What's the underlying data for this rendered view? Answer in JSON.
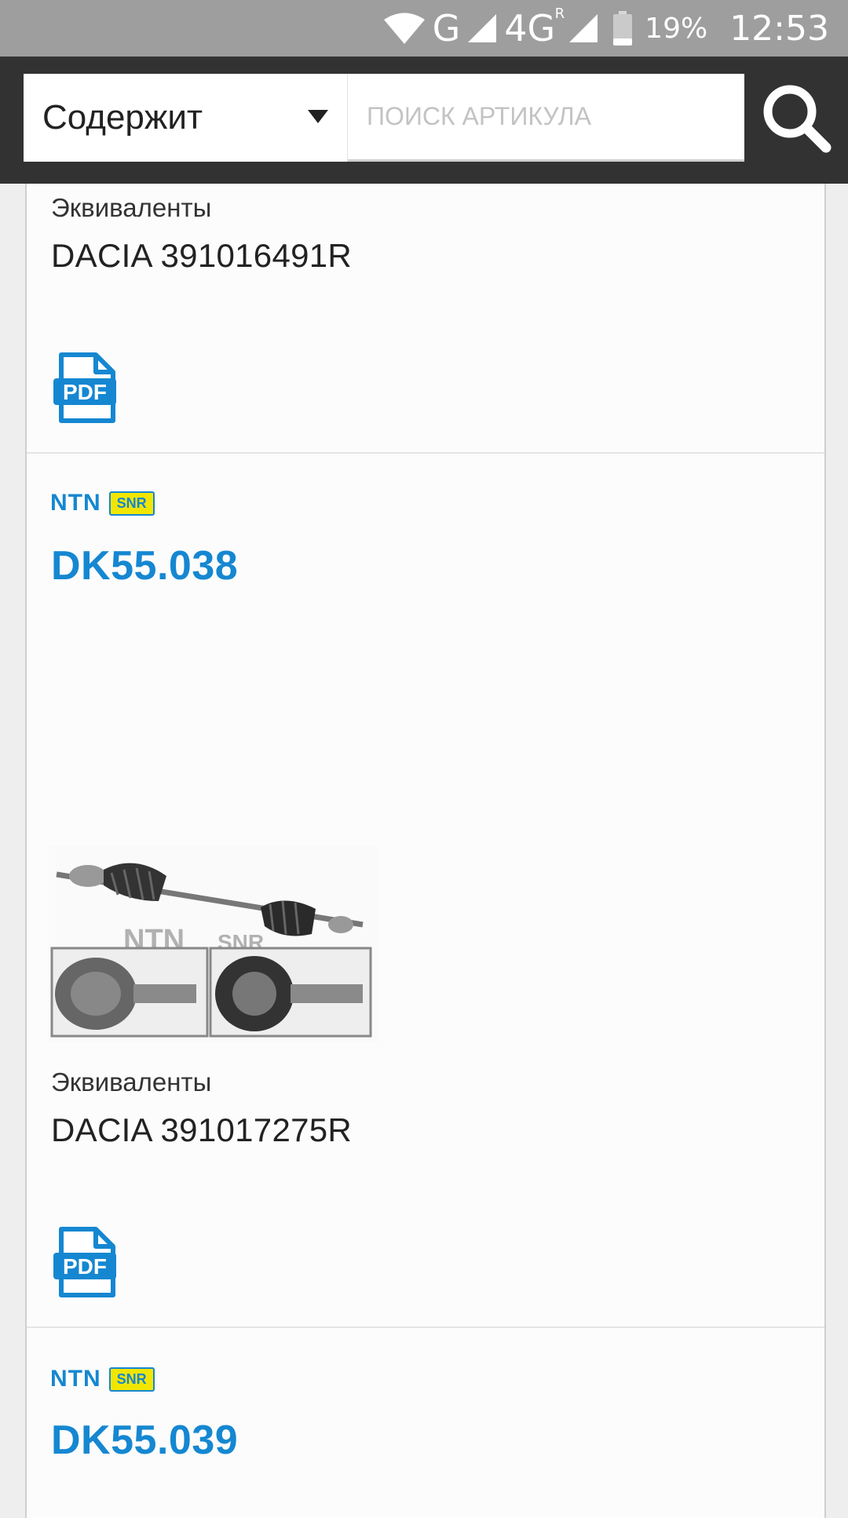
{
  "status_bar": {
    "network_g": "G",
    "network_4g": "4G",
    "roaming": "R",
    "battery_percent": "19%",
    "time": "12:53",
    "icons": [
      "wifi-icon",
      "signal-icon",
      "signal-icon",
      "battery-icon"
    ]
  },
  "search": {
    "filter_label": "Содержит",
    "placeholder": "ПОИСК АРТИКУЛА",
    "button_icon": "search-icon"
  },
  "results": [
    {
      "equivalents_label": "Эквиваленты",
      "equivalents_value": "DACIA 391016491R",
      "pdf_label": "PDF"
    },
    {
      "brand_ntn": "NTN",
      "brand_snr": "SNR",
      "part_number": "DK55.038",
      "image": "drive-shaft-image",
      "image_watermark_ntn": "NTN",
      "image_watermark_snr": "SNR",
      "equivalents_label": "Эквиваленты",
      "equivalents_value": "DACIA 391017275R",
      "pdf_label": "PDF"
    },
    {
      "brand_ntn": "NTN",
      "brand_snr": "SNR",
      "part_number": "DK55.039"
    }
  ],
  "colors": {
    "status_bar": "#9e9e9e",
    "header": "#323232",
    "accent_blue": "#1587d1",
    "snr_yellow": "#f2e600"
  }
}
